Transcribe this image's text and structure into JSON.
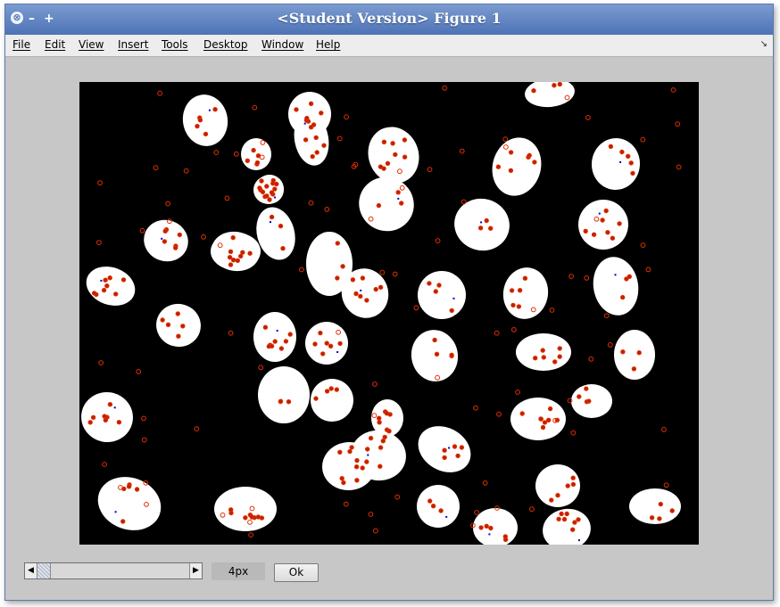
{
  "window": {
    "title": "<Student Version> Figure 1",
    "controls": {
      "close": "⊗",
      "minimize": "–",
      "maximize": "+"
    }
  },
  "menu": {
    "file": "File",
    "edit": "Edit",
    "view": "View",
    "insert": "Insert",
    "tools": "Tools",
    "desktop": "Desktop",
    "window": "Window",
    "help": "Help",
    "dock_glyph": "↘"
  },
  "controls": {
    "slider_left_glyph": "◀",
    "slider_right_glyph": "▶",
    "value_label": "4px",
    "ok_label": "Ok"
  },
  "colors": {
    "background": "#000000",
    "cell": "#ffffff",
    "marker": "#e03000",
    "marker_core": "#c02000",
    "blue_marker": "#0000cc"
  }
}
